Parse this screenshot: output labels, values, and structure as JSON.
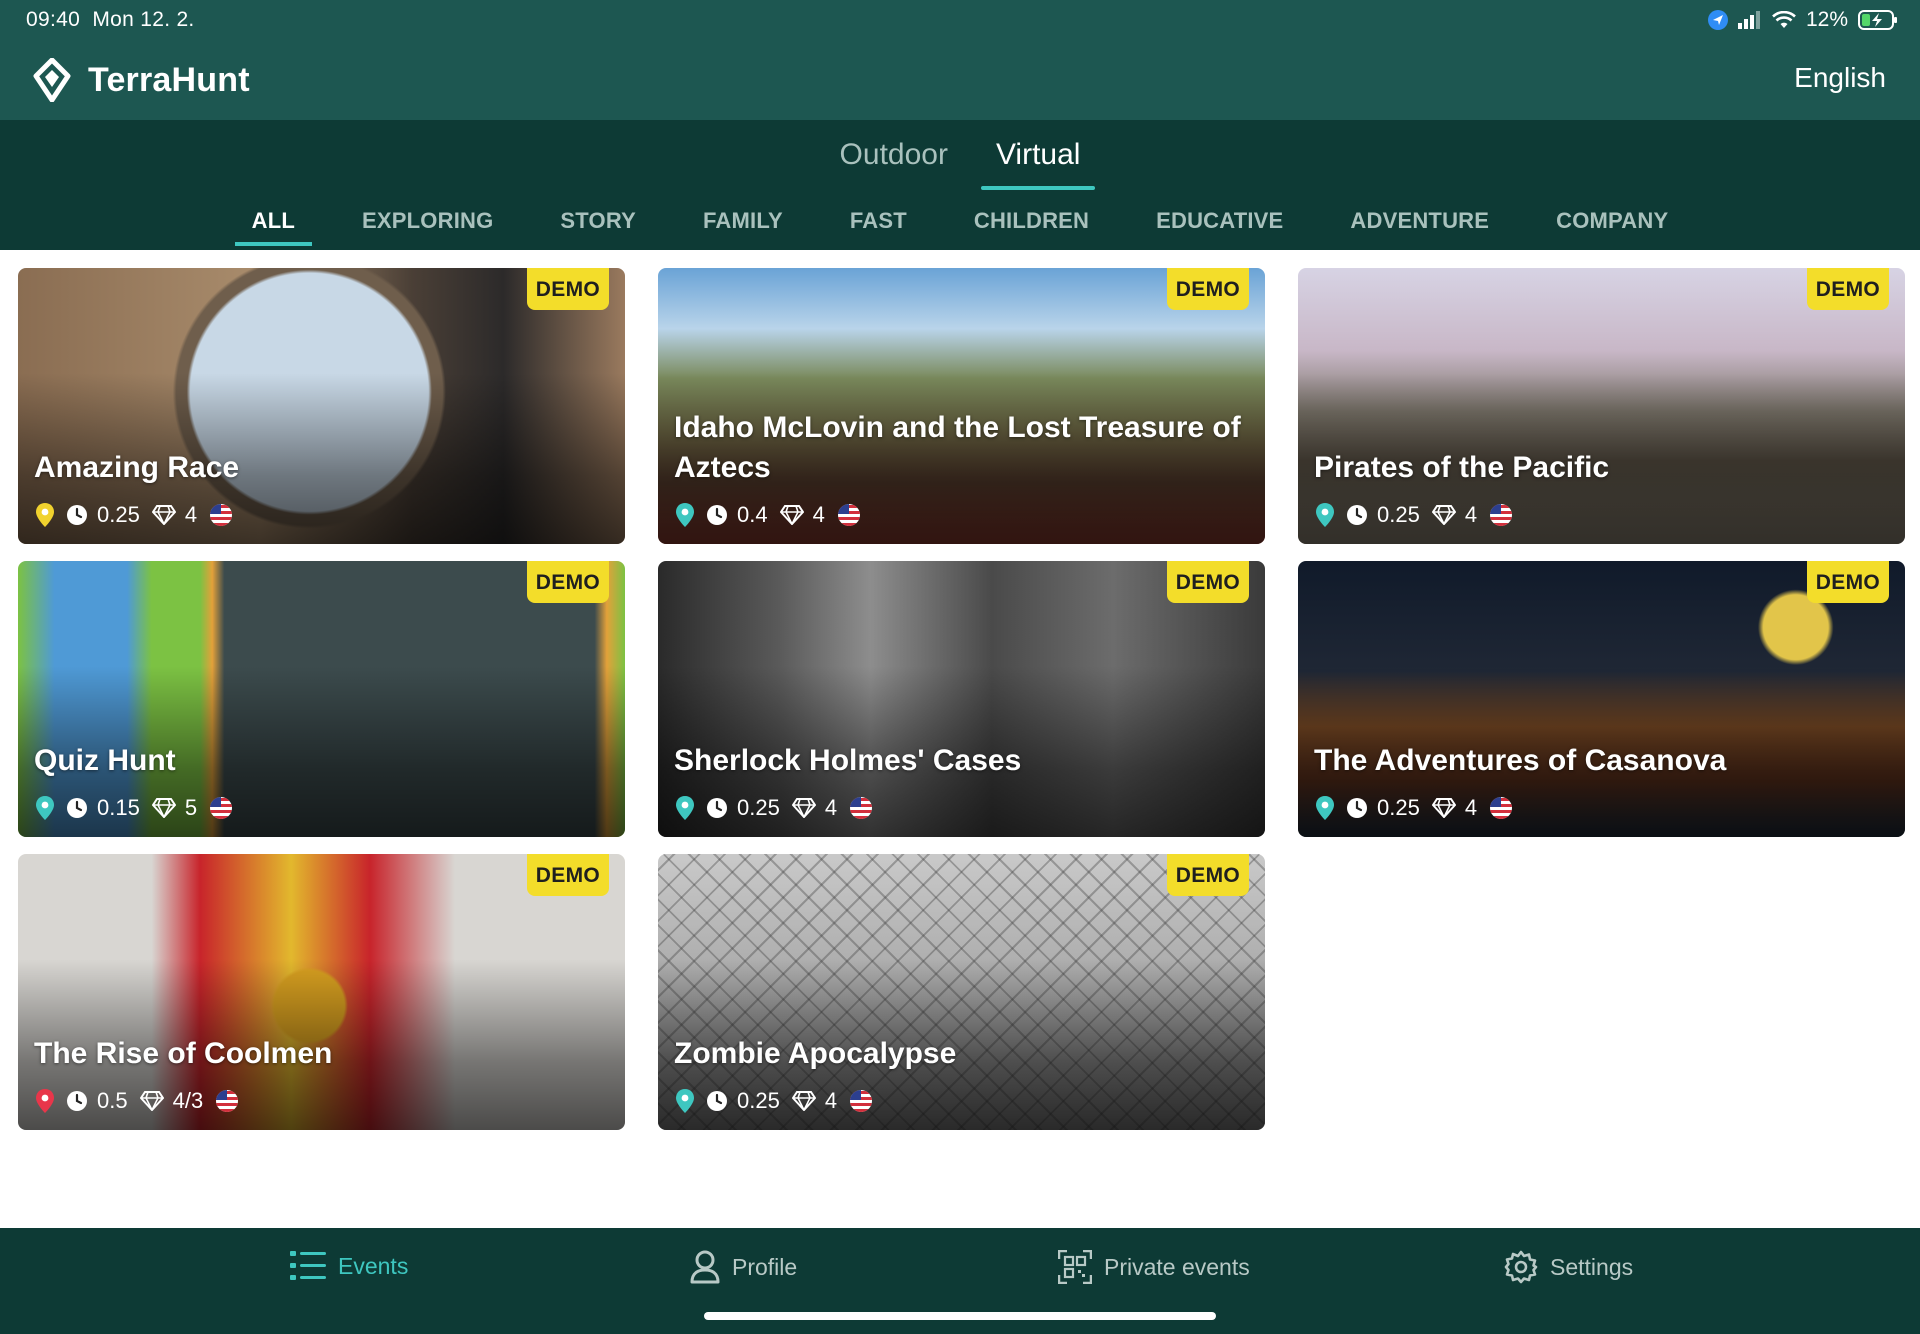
{
  "status_bar": {
    "time": "09:40",
    "date": "Mon 12. 2.",
    "battery": "12%"
  },
  "header": {
    "app_name": "TerraHunt",
    "language": "English"
  },
  "mode_tabs": [
    {
      "label": "Outdoor",
      "active": false
    },
    {
      "label": "Virtual",
      "active": true
    }
  ],
  "category_tabs": [
    {
      "label": "ALL",
      "active": true
    },
    {
      "label": "EXPLORING"
    },
    {
      "label": "STORY"
    },
    {
      "label": "FAMILY"
    },
    {
      "label": "FAST"
    },
    {
      "label": "CHILDREN"
    },
    {
      "label": "EDUCATIVE"
    },
    {
      "label": "ADVENTURE"
    },
    {
      "label": "COMPANY"
    }
  ],
  "badge_label": "DEMO",
  "events": [
    {
      "title": "Amazing Race",
      "duration": "0.25",
      "gems": "4",
      "pin_color": "#f1d22e"
    },
    {
      "title": "Idaho McLovin and the Lost Treasure of Aztecs",
      "duration": "0.4",
      "gems": "4",
      "pin_color": "#3ec7c0"
    },
    {
      "title": "Pirates of the Pacific",
      "duration": "0.25",
      "gems": "4",
      "pin_color": "#3ec7c0"
    },
    {
      "title": "Quiz Hunt",
      "duration": "0.15",
      "gems": "5",
      "pin_color": "#3ec7c0"
    },
    {
      "title": "Sherlock Holmes' Cases",
      "duration": "0.25",
      "gems": "4",
      "pin_color": "#3ec7c0"
    },
    {
      "title": "The Adventures of Casanova",
      "duration": "0.25",
      "gems": "4",
      "pin_color": "#3ec7c0"
    },
    {
      "title": "The Rise of Coolmen",
      "duration": "0.5",
      "gems": "4/3",
      "pin_color": "#e8364a"
    },
    {
      "title": "Zombie Apocalypse",
      "duration": "0.25",
      "gems": "4",
      "pin_color": "#3ec7c0"
    }
  ],
  "bottom_nav": [
    {
      "label": "Events",
      "icon": "list-icon",
      "active": true
    },
    {
      "label": "Profile",
      "icon": "profile-icon"
    },
    {
      "label": "Private events",
      "icon": "qr-code-icon"
    },
    {
      "label": "Settings",
      "icon": "gear-icon"
    }
  ],
  "colors": {
    "header_bg": "#1d5751",
    "tabs_bg": "#0d3a35",
    "accent": "#3ec7c0",
    "demo_badge": "#f3dd2a"
  }
}
